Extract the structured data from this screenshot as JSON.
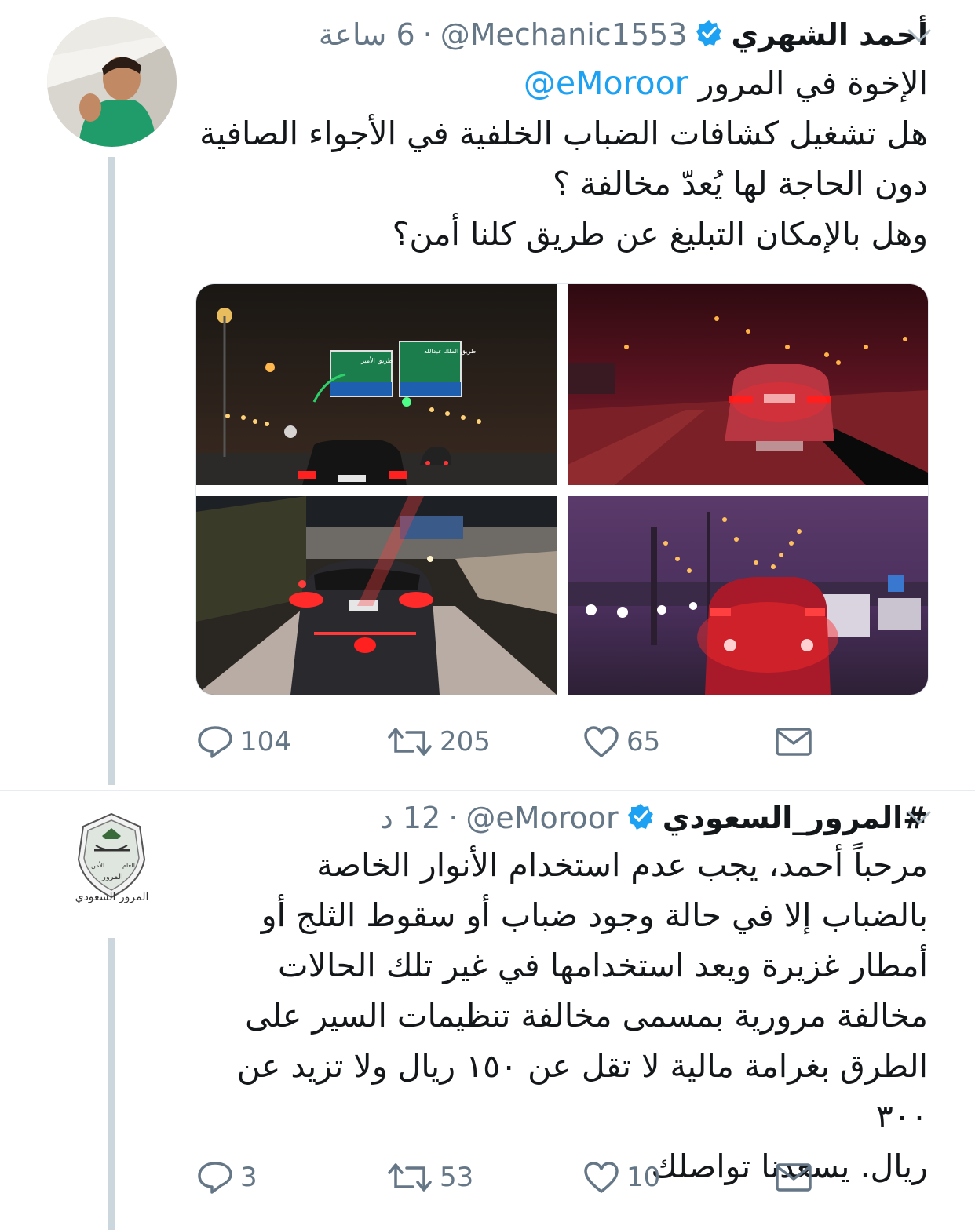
{
  "tweet1": {
    "name": "أحمد الشهري",
    "handle": "@Mechanic1553",
    "time": "6 ساعة",
    "separator": "·",
    "line1_text": "الإخوة في المرور",
    "line1_mention": "@eMoroor",
    "lines": [
      "هل تشغيل كشافات الضباب الخلفية في الأجواء الصافية",
      "دون الحاجة لها يُعدّ مخالفة ؟",
      "وهل بالإمكان التبليغ عن طريق كلنا أمن؟"
    ],
    "photos": [
      {
        "desc": "night highway with green road signs"
      },
      {
        "desc": "car with red rear fog lights"
      },
      {
        "desc": "car under bridge with fog lights"
      },
      {
        "desc": "car with fog lights on purple highway"
      }
    ],
    "sign_texts": [
      "طريق الملك عبدالله",
      "طريق الأمير"
    ],
    "actions": {
      "reply": "104",
      "retweet": "205",
      "like": "65"
    }
  },
  "tweet2": {
    "name": "#المرور_السعودي",
    "handle": "@eMoroor",
    "time": "12 د",
    "separator": "·",
    "logo_caption": "المرور السعودي",
    "logo_inner": [
      "الأمن",
      "العام",
      "المرور"
    ],
    "lines": [
      "مرحباً أحمد، يجب عدم استخدام الأنوار الخاصة",
      "بالضباب إلا في حالة وجود ضباب أو سقوط الثلج أو",
      "أمطار غزيرة ويعد استخدامها في غير تلك الحالات",
      "مخالفة مرورية بمسمى مخالفة تنظيمات السير على",
      "الطرق بغرامة مالية لا تقل عن ١٥٠ ريال ولا تزيد عن ٣٠٠",
      "ريال. يسعدنا تواصلك"
    ],
    "actions": {
      "reply": "3",
      "retweet": "53",
      "like": "10"
    }
  },
  "colors": {
    "link": "#1da1f2",
    "verified": "#1da1f2",
    "muted": "#657786",
    "thread": "#ccd6dd"
  }
}
